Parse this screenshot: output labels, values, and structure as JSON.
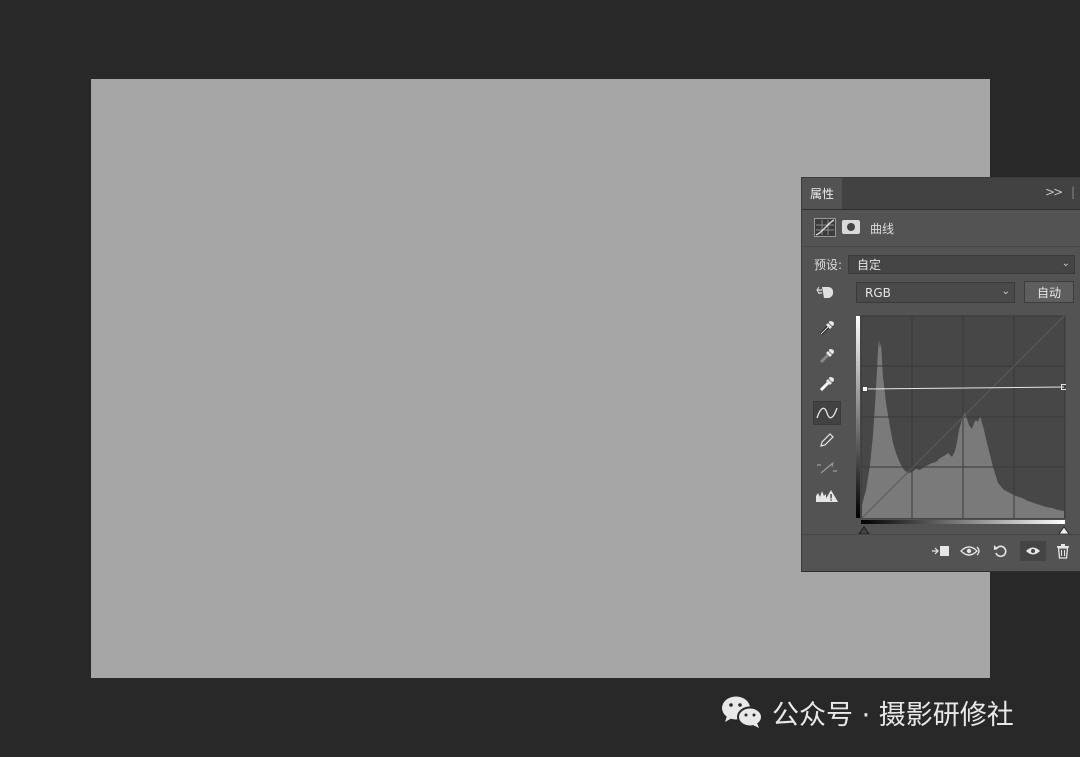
{
  "panel": {
    "tab_label": "属性",
    "collapse_glyph": ">>",
    "adjustment_title": "曲线",
    "preset_label": "预设:",
    "preset_value": "自定",
    "channel_value": "RGB",
    "auto_label": "自动"
  },
  "watermark": {
    "text": "公众号 · 摄影研修社"
  },
  "colors": {
    "workspace": "#282828",
    "canvas": "#a6a6a6",
    "panel": "#535353"
  }
}
